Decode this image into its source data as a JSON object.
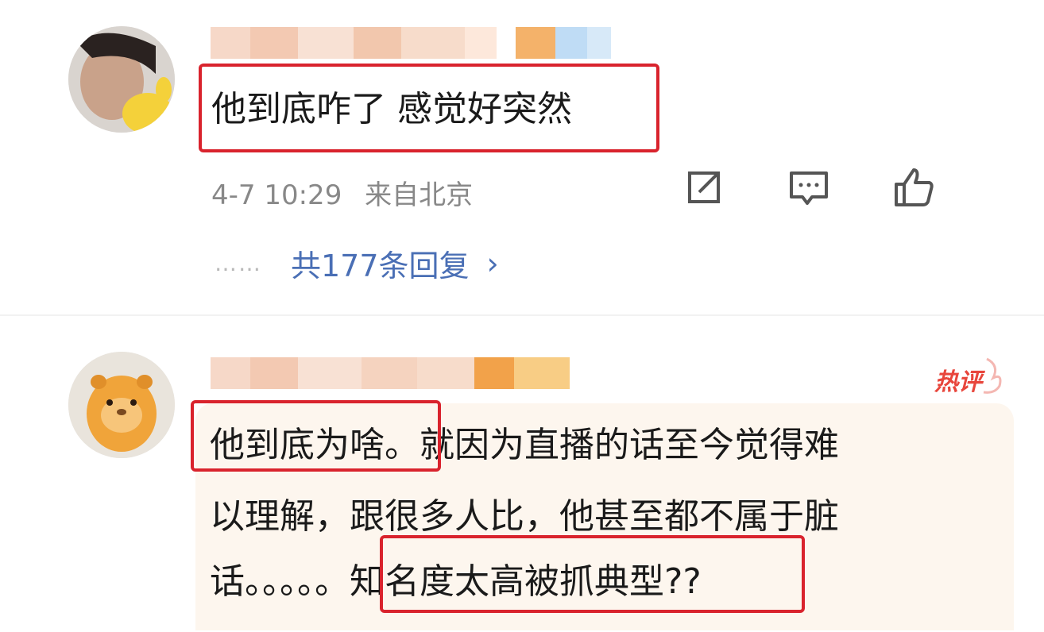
{
  "comments": [
    {
      "text": "他到底咋了 感觉好突然",
      "time": "4-7 10:29",
      "location": "来自北京",
      "replies_dots": "……",
      "replies_label": "共177条回复",
      "replies_chevron": "›"
    },
    {
      "hot_label": "热评",
      "lines": [
        "他到底为啥。就因为直播的话至今觉得难",
        "以理解，跟很多人比，他甚至都不属于脏",
        "话。。。。。知名度太高被抓典型??"
      ]
    }
  ],
  "colors": {
    "highlight_box": "#d9232d",
    "link": "#4a6fb5",
    "meta": "#888888",
    "hot": "#e8463c"
  },
  "icons": [
    "share-icon",
    "comment-icon",
    "like-icon"
  ]
}
